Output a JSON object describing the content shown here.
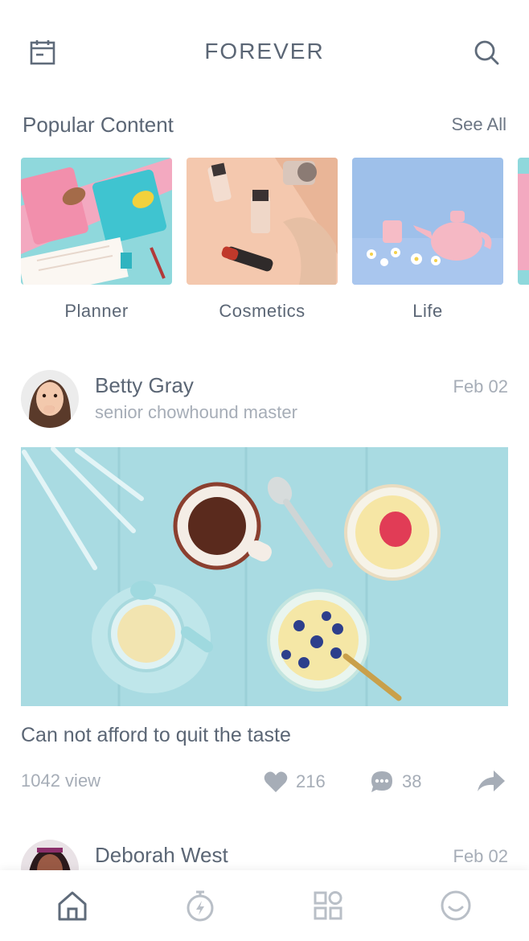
{
  "header": {
    "title": "FOREVER",
    "left_icon": "calendar-icon",
    "right_icon": "search-icon"
  },
  "popular": {
    "title": "Popular Content",
    "see_all": "See All",
    "items": [
      {
        "label": "Planner"
      },
      {
        "label": "Cosmetics"
      },
      {
        "label": "Life"
      }
    ]
  },
  "posts": [
    {
      "author": "Betty Gray",
      "role": "senior chowhound master",
      "date": "Feb 02",
      "caption": "Can not afford to quit the taste",
      "views": "1042 view",
      "likes": "216",
      "comments": "38"
    },
    {
      "author": "Deborah West",
      "date": "Feb 02"
    }
  ],
  "tabbar": {
    "items": [
      "home-icon",
      "timer-icon",
      "apps-grid-icon",
      "profile-smile-icon"
    ]
  },
  "colors": {
    "text": "#5b6675",
    "muted": "#a6adb7",
    "icon": "#5f6b7a",
    "icon_muted": "#b9bfc7"
  }
}
